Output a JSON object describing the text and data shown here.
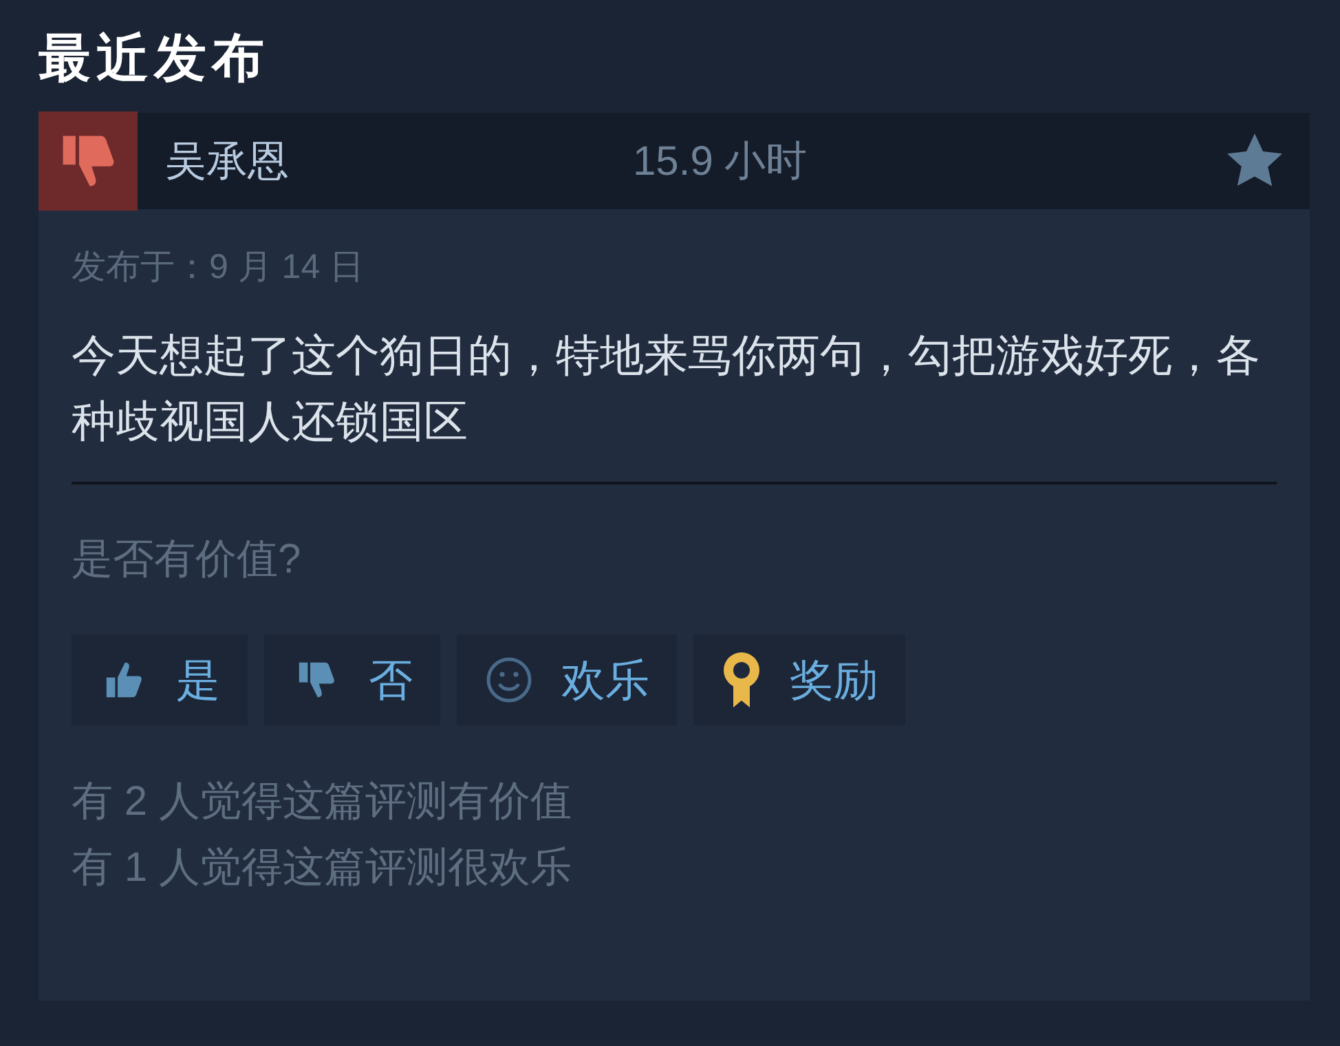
{
  "section_title": "最近发布",
  "review": {
    "recommended": false,
    "author": "吴承恩",
    "playtime": "15.9 小时",
    "posted": "发布于：9 月 14 日",
    "text": "今天想起了这个狗日的，特地来骂你两句，勾把游戏好死，各种歧视国人还锁国区"
  },
  "helpful_prompt": "是否有价值?",
  "buttons": [
    {
      "kind": "yes",
      "label": "是"
    },
    {
      "kind": "no",
      "label": "否"
    },
    {
      "kind": "funny",
      "label": "欢乐"
    },
    {
      "kind": "award",
      "label": "奖励"
    }
  ],
  "stats": [
    "有 2 人觉得这篇评测有价值",
    "有 1 人觉得这篇评测很欢乐"
  ]
}
